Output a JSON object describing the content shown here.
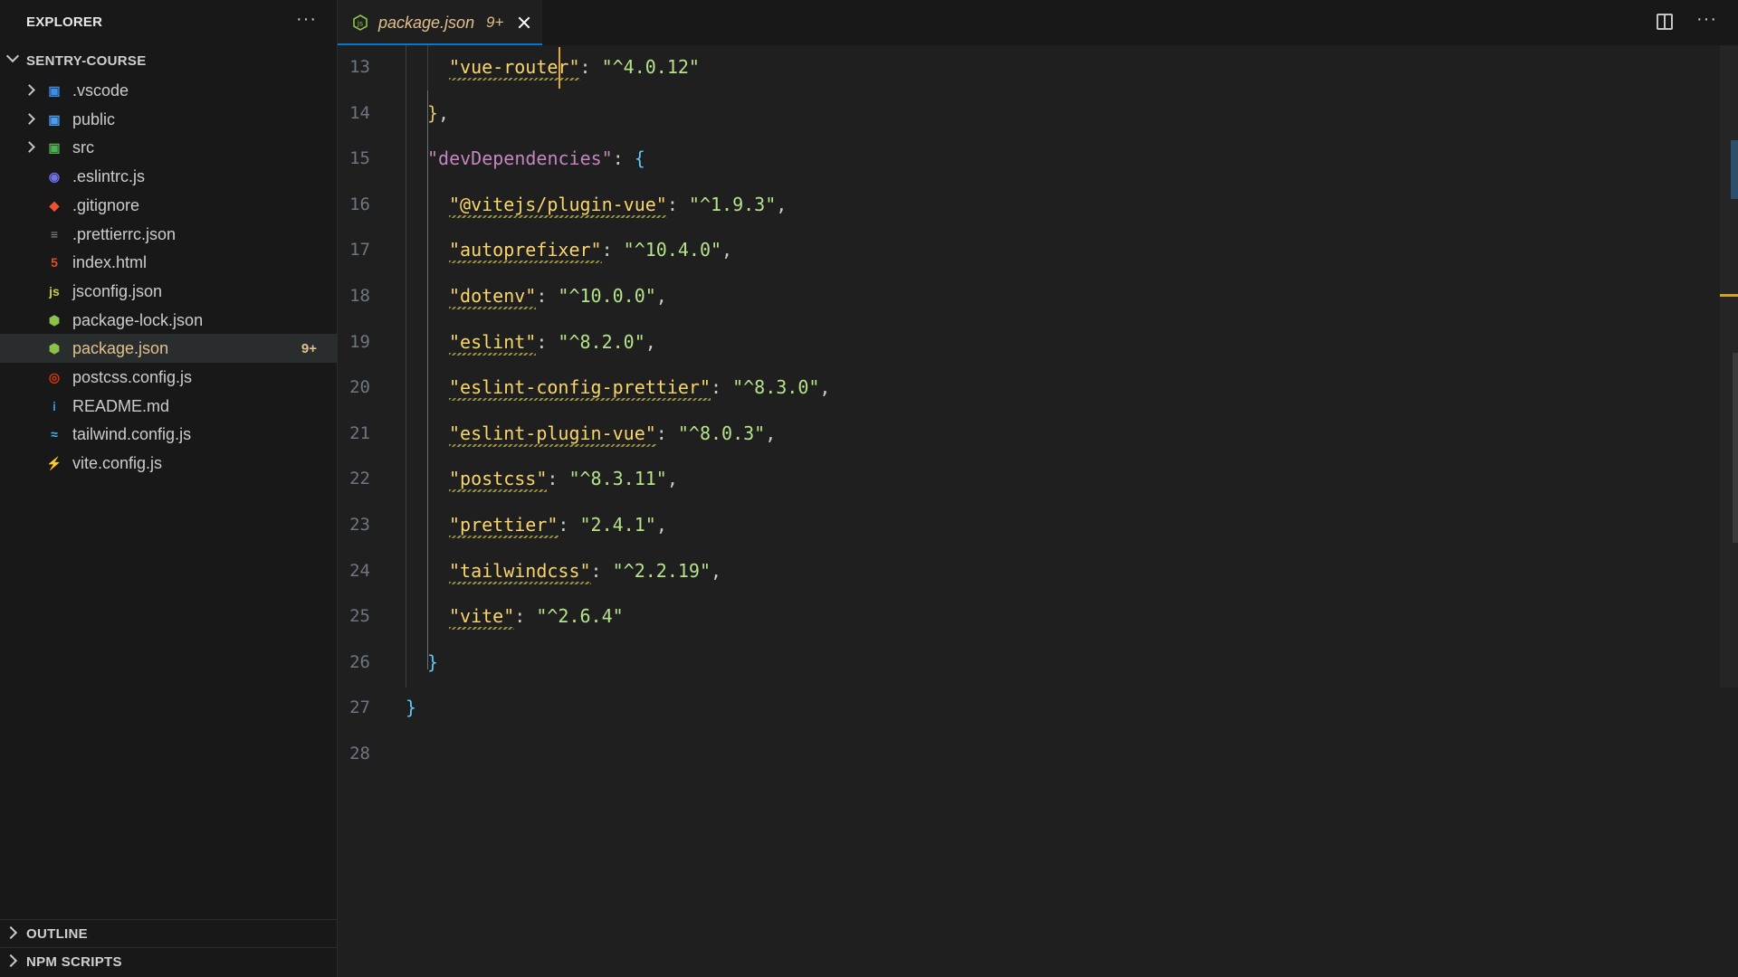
{
  "sidebar": {
    "title": "EXPLORER",
    "more_label": "···",
    "folder": "SENTRY-COURSE",
    "items": [
      {
        "label": ".vscode",
        "kind": "folder",
        "icon": "vscode-folder-icon",
        "color": "#3b8eea",
        "glyph": "▣"
      },
      {
        "label": "public",
        "kind": "folder",
        "icon": "public-folder-icon",
        "color": "#4a9df0",
        "glyph": "▣"
      },
      {
        "label": "src",
        "kind": "folder",
        "icon": "src-folder-icon",
        "color": "#4caf50",
        "glyph": "▣"
      },
      {
        "label": ".eslintrc.js",
        "kind": "file",
        "icon": "eslint-icon",
        "color": "#6d73e4",
        "glyph": "◉"
      },
      {
        "label": ".gitignore",
        "kind": "file",
        "icon": "git-icon",
        "color": "#f05133",
        "glyph": "◆"
      },
      {
        "label": ".prettierrc.json",
        "kind": "file",
        "icon": "prettier-icon",
        "color": "#8e8e8e",
        "glyph": "≡"
      },
      {
        "label": "index.html",
        "kind": "file",
        "icon": "html-icon",
        "color": "#e44d26",
        "glyph": "5"
      },
      {
        "label": "jsconfig.json",
        "kind": "file",
        "icon": "jsconfig-icon",
        "color": "#cbcb41",
        "glyph": "js"
      },
      {
        "label": "package-lock.json",
        "kind": "file",
        "icon": "nodejs-icon",
        "color": "#8bc34a",
        "glyph": "⬢"
      },
      {
        "label": "package.json",
        "kind": "file",
        "icon": "nodejs-icon",
        "color": "#8bc34a",
        "glyph": "⬢",
        "badge": "9+",
        "active": true
      },
      {
        "label": "postcss.config.js",
        "kind": "file",
        "icon": "postcss-icon",
        "color": "#dd3a0a",
        "glyph": "◎"
      },
      {
        "label": "README.md",
        "kind": "file",
        "icon": "info-icon",
        "color": "#3b8eea",
        "glyph": "i"
      },
      {
        "label": "tailwind.config.js",
        "kind": "file",
        "icon": "tailwind-icon",
        "color": "#38bdf8",
        "glyph": "≈"
      },
      {
        "label": "vite.config.js",
        "kind": "file",
        "icon": "vite-icon",
        "color": "#ffc517",
        "glyph": "⚡"
      }
    ],
    "outline_label": "OUTLINE",
    "npm_label": "NPM SCRIPTS"
  },
  "tab": {
    "filename": "package.json",
    "badge": "9+"
  },
  "editor": {
    "more_label": "···",
    "lines": [
      {
        "n": "13",
        "indent": 2,
        "parts": [
          [
            "key2",
            "\"vue-router\""
          ],
          [
            "punc",
            ": "
          ],
          [
            "str",
            "\"^4.0.12\""
          ]
        ]
      },
      {
        "n": "14",
        "indent": 1,
        "parts": [
          [
            "brace2",
            "}"
          ],
          [
            "punc",
            ","
          ]
        ]
      },
      {
        "n": "15",
        "indent": 1,
        "parts": [
          [
            "dd",
            "\"devDependencies\""
          ],
          [
            "punc",
            ": "
          ],
          [
            "brace",
            "{"
          ]
        ]
      },
      {
        "n": "16",
        "indent": 2,
        "parts": [
          [
            "key2",
            "\"@vitejs/plugin-vue\""
          ],
          [
            "punc",
            ": "
          ],
          [
            "str",
            "\"^1.9.3\""
          ],
          [
            "punc",
            ","
          ]
        ]
      },
      {
        "n": "17",
        "indent": 2,
        "parts": [
          [
            "key2",
            "\"autoprefixer\""
          ],
          [
            "punc",
            ": "
          ],
          [
            "str",
            "\"^10.4.0\""
          ],
          [
            "punc",
            ","
          ]
        ]
      },
      {
        "n": "18",
        "indent": 2,
        "parts": [
          [
            "key2",
            "\"dotenv\""
          ],
          [
            "punc",
            ": "
          ],
          [
            "str",
            "\"^10.0.0\""
          ],
          [
            "punc",
            ","
          ]
        ]
      },
      {
        "n": "19",
        "indent": 2,
        "parts": [
          [
            "key2",
            "\"eslint\""
          ],
          [
            "punc",
            ": "
          ],
          [
            "str",
            "\"^8.2.0\""
          ],
          [
            "punc",
            ","
          ]
        ]
      },
      {
        "n": "20",
        "indent": 2,
        "parts": [
          [
            "key2",
            "\"eslint-config-prettier\""
          ],
          [
            "punc",
            ": "
          ],
          [
            "str",
            "\"^8.3.0\""
          ],
          [
            "punc",
            ","
          ]
        ]
      },
      {
        "n": "21",
        "indent": 2,
        "parts": [
          [
            "key2",
            "\"eslint-plugin-vue\""
          ],
          [
            "punc",
            ": "
          ],
          [
            "str",
            "\"^8.0.3\""
          ],
          [
            "punc",
            ","
          ]
        ]
      },
      {
        "n": "22",
        "indent": 2,
        "parts": [
          [
            "key2",
            "\"postcss\""
          ],
          [
            "punc",
            ": "
          ],
          [
            "str",
            "\"^8.3.11\""
          ],
          [
            "punc",
            ","
          ]
        ]
      },
      {
        "n": "23",
        "indent": 2,
        "parts": [
          [
            "key2",
            "\"prettier\""
          ],
          [
            "punc",
            ": "
          ],
          [
            "str",
            "\"2.4.1\""
          ],
          [
            "punc",
            ","
          ]
        ]
      },
      {
        "n": "24",
        "indent": 2,
        "parts": [
          [
            "key2",
            "\"tailwindcss\""
          ],
          [
            "punc",
            ": "
          ],
          [
            "str",
            "\"^2.2.19\""
          ],
          [
            "punc",
            ","
          ]
        ]
      },
      {
        "n": "25",
        "indent": 2,
        "parts": [
          [
            "key2",
            "\"vite\""
          ],
          [
            "punc",
            ": "
          ],
          [
            "str",
            "\"^2.6.4\""
          ]
        ]
      },
      {
        "n": "26",
        "indent": 1,
        "parts": [
          [
            "brace",
            "}"
          ]
        ]
      },
      {
        "n": "27",
        "indent": 0,
        "parts": [
          [
            "brace",
            "}"
          ]
        ]
      },
      {
        "n": "28",
        "indent": 0,
        "parts": []
      }
    ]
  }
}
